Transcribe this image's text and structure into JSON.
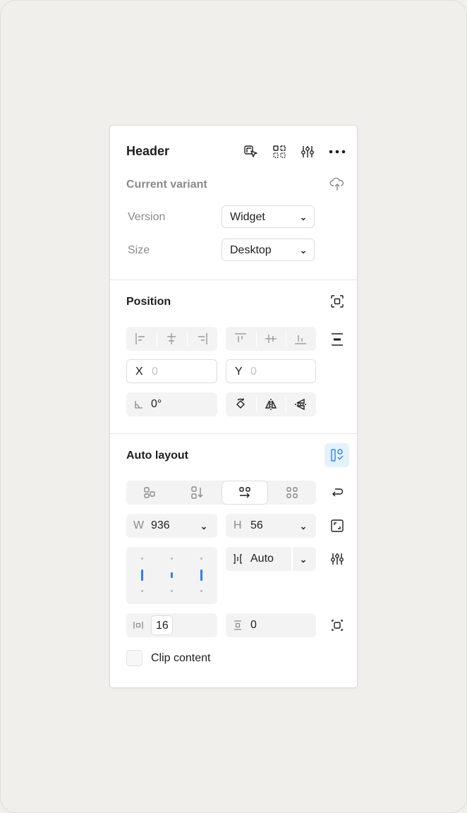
{
  "header": {
    "title": "Header",
    "icons": [
      "select-instances-icon",
      "component-grid-icon",
      "adjust-icon",
      "more-icon"
    ]
  },
  "variant": {
    "title": "Current variant",
    "properties": [
      {
        "label": "Version",
        "value": "Widget"
      },
      {
        "label": "Size",
        "value": "Desktop"
      }
    ]
  },
  "position": {
    "title": "Position",
    "x_label": "X",
    "x_value": "0",
    "y_label": "Y",
    "y_value": "0",
    "rotation": "0°"
  },
  "auto_layout": {
    "title": "Auto layout",
    "direction_selected": "horizontal",
    "w_label": "W",
    "w_value": "936",
    "h_label": "H",
    "h_value": "56",
    "gap_value": "Auto",
    "padding_horizontal": "16",
    "padding_vertical": "0",
    "clip_label": "Clip content",
    "clip_checked": false
  },
  "colors": {
    "accent": "#2f80ed",
    "accent_bg": "#e5f1fd",
    "panel_bg": "#ffffff",
    "canvas_bg": "#f0efec"
  }
}
